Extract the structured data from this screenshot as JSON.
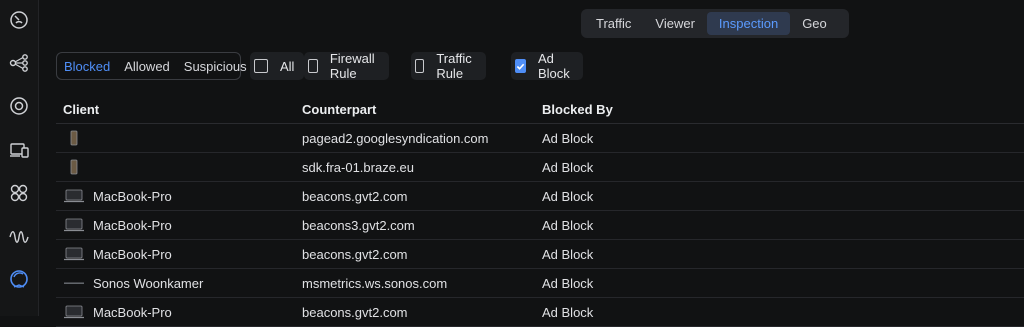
{
  "sidebar": {
    "icons": [
      "dashboard-icon",
      "topology-icon",
      "unifi-devices-icon",
      "client-devices-icon",
      "apps-icon",
      "signal-icon",
      "insights-icon"
    ],
    "active": "insights-icon",
    "accent": "#4f8ef7"
  },
  "tabs": [
    {
      "label": "Traffic",
      "active": false
    },
    {
      "label": "Viewer",
      "active": false
    },
    {
      "label": "Inspection",
      "active": true
    },
    {
      "label": "Geo",
      "active": false
    }
  ],
  "filters": {
    "segment": [
      {
        "label": "Blocked",
        "active": true
      },
      {
        "label": "Allowed",
        "active": false
      },
      {
        "label": "Suspicious",
        "active": false
      }
    ],
    "checkboxes": [
      {
        "label": "All",
        "checked": false
      },
      {
        "label": "Firewall Rule",
        "checked": false
      },
      {
        "label": "Traffic Rule",
        "checked": false
      },
      {
        "label": "Ad Block",
        "checked": true
      }
    ]
  },
  "table": {
    "headers": [
      "Client",
      "Counterpart",
      "Blocked By"
    ],
    "rows": [
      {
        "client": "",
        "icon": "phone-icon",
        "counterpart": "pagead2.googlesyndication.com",
        "blocked_by": "Ad Block"
      },
      {
        "client": "",
        "icon": "phone-icon",
        "counterpart": "sdk.fra-01.braze.eu",
        "blocked_by": "Ad Block"
      },
      {
        "client": "MacBook-Pro",
        "icon": "laptop-icon",
        "counterpart": "beacons.gvt2.com",
        "blocked_by": "Ad Block"
      },
      {
        "client": "MacBook-Pro",
        "icon": "laptop-icon",
        "counterpart": "beacons3.gvt2.com",
        "blocked_by": "Ad Block"
      },
      {
        "client": "MacBook-Pro",
        "icon": "laptop-icon",
        "counterpart": "beacons.gvt2.com",
        "blocked_by": "Ad Block"
      },
      {
        "client": "Sonos Woonkamer",
        "icon": "speaker-icon",
        "counterpart": "msmetrics.ws.sonos.com",
        "blocked_by": "Ad Block"
      },
      {
        "client": "MacBook-Pro",
        "icon": "laptop-icon",
        "counterpart": "beacons.gvt2.com",
        "blocked_by": "Ad Block"
      }
    ]
  }
}
